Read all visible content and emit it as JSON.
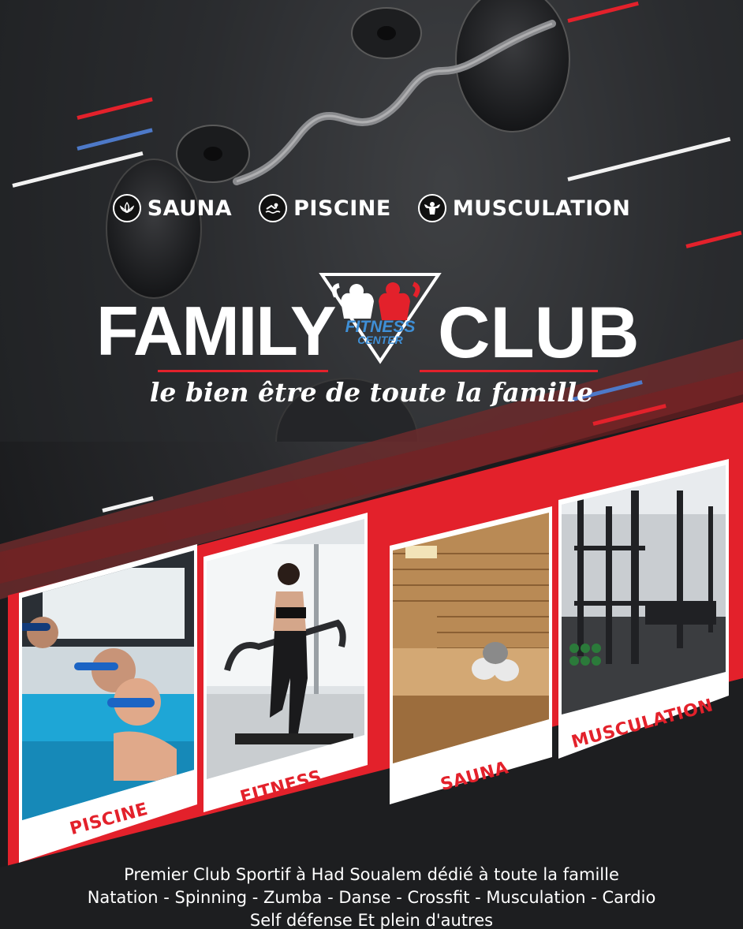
{
  "features": [
    {
      "label": "SAUNA",
      "icon": "lotus-icon"
    },
    {
      "label": "PISCINE",
      "icon": "swimmer-icon"
    },
    {
      "label": "MUSCULATION",
      "icon": "bodybuilder-icon"
    }
  ],
  "brand": {
    "word_left": "FAMILY",
    "word_right": "CLUB",
    "logo_line1": "FITNESS",
    "logo_line2": "CENTER",
    "tagline": "le bien être de toute la famille"
  },
  "panels": [
    {
      "label": "PISCINE"
    },
    {
      "label": "FITNESS"
    },
    {
      "label": "SAUNA"
    },
    {
      "label": "MUSCULATION"
    }
  ],
  "footer": {
    "line1": "Premier Club Sportif à Had Soualem dédié à toute la famille",
    "line2": "Natation - Spinning - Zumba - Danse - Crossfit - Musculation - Cardio",
    "line3": "Self défense Et plein d'autres"
  },
  "colors": {
    "red": "#e3212b",
    "blue": "#4d79c8",
    "dark": "#1b1c1e",
    "logo_blue": "#3f8fd6"
  }
}
